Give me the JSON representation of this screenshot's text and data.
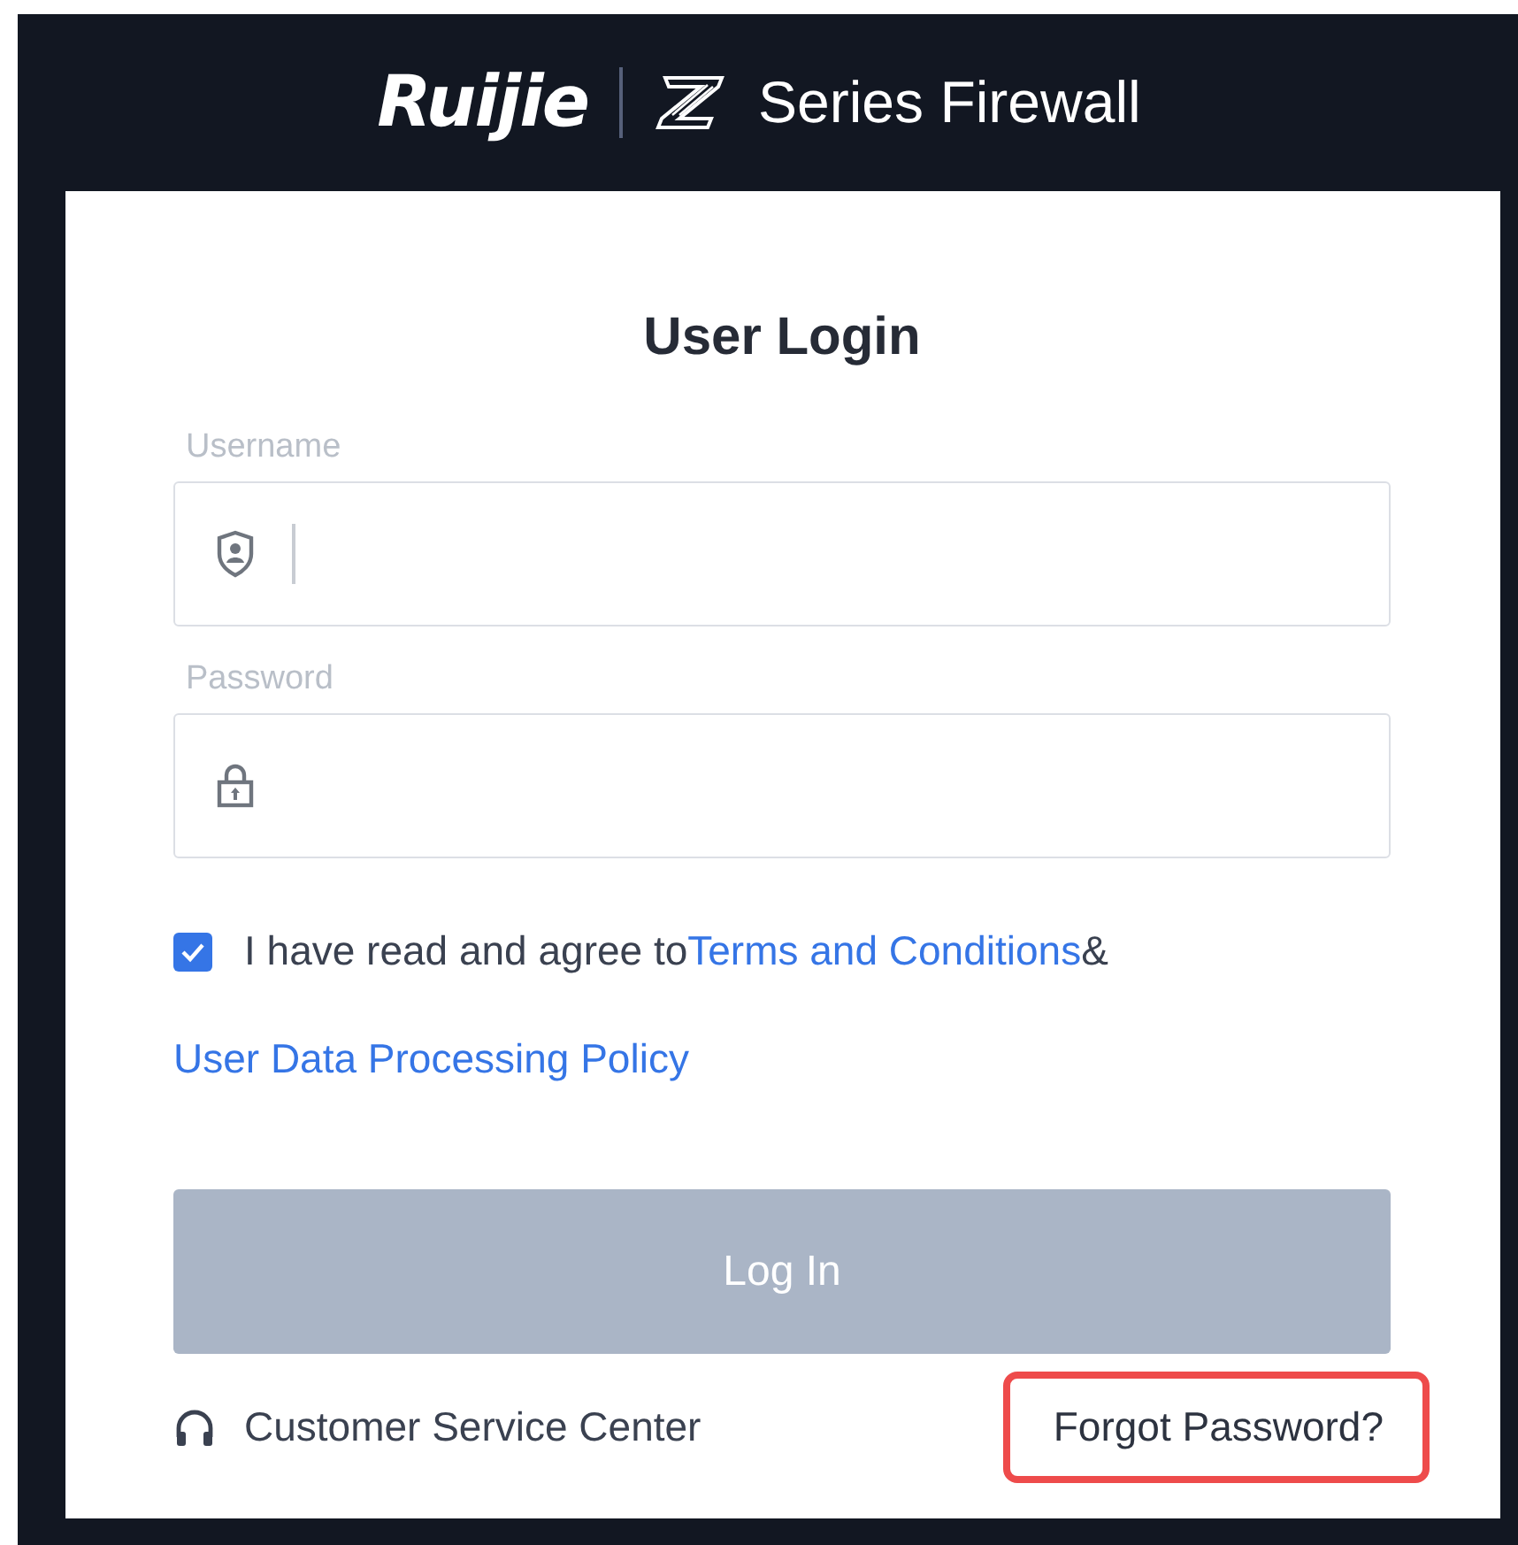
{
  "header": {
    "logo": "Ruijie",
    "product": "Series Firewall"
  },
  "login": {
    "title": "User Login",
    "fields": [
      {
        "kind": "username",
        "label": "Username",
        "focused": true
      },
      {
        "kind": "password",
        "label": "Password",
        "focused": false
      }
    ],
    "agreement": {
      "checked": true,
      "text": "I have read and agree to",
      "terms_link": "Terms and Conditions",
      "joiner": "&",
      "policy_link": "User Data Processing Policy"
    },
    "login_button": {
      "label": "Log In",
      "disabled": true
    },
    "customer_service": "Customer Service Center",
    "forgot_password": {
      "text": "Forgot Password?",
      "highlighted": true
    }
  }
}
